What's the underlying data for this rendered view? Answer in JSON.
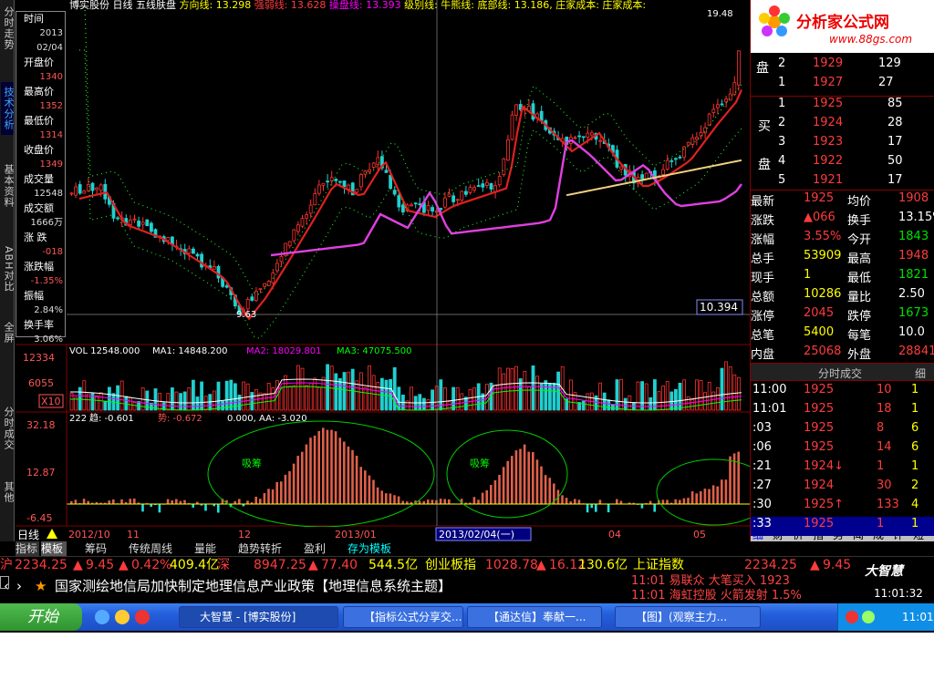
{
  "side_tabs": [
    "分时走势",
    "技术分析",
    "基本资料",
    "ABH对比",
    "全屏",
    "分时成交",
    "其他"
  ],
  "info": {
    "time_label": "时间",
    "time_year": "2013",
    "time_date": "02/04",
    "open_label": "开盘价",
    "open": "1340",
    "high_label": "最高价",
    "high": "1352",
    "low_label": "最低价",
    "low": "1314",
    "close_label": "收盘价",
    "close": "1349",
    "vol_label": "成交量",
    "vol": "12548",
    "amt_label": "成交额",
    "amt": "1666万",
    "chg_label": "涨 跌",
    "chg": "-018",
    "chgpct_label": "涨跌幅",
    "chgpct": "-1.35%",
    "amp_label": "振幅",
    "amp": "2.84%",
    "turn_label": "换手率",
    "turn": "3.06%"
  },
  "main_title": {
    "stock": "博实股份",
    "period": "日线",
    "indicator": "五线肤盘",
    "l1": "方向线: 13.298",
    "l2": "强弱线: 13.628",
    "l3": "操盘线: 13.393",
    "l4": "级别线: 牛熊线: 底部线: 13.186, 庄家成本: 庄家成本:",
    "top_price": "19.48",
    "low_mark": "9.63",
    "price_box": "10.394"
  },
  "vol_panel": {
    "title": "VOL 12548.000",
    "ma1": "MA1: 14848.200",
    "ma2": "MA2: 18029.801",
    "ma3": "MA3: 47075.500",
    "y1": "12334",
    "y2": "6055",
    "y3": "X10"
  },
  "ind_panel": {
    "title": "222",
    "qu": "趋: -0.601",
    "shi": "势: -0.672",
    "z": "0.000, AA: -3.020",
    "y1": "32.18",
    "y2": "12.87",
    "y3": "-6.45",
    "label1": "吸筹",
    "label2": "吸筹"
  },
  "xaxis": {
    "period": "日线",
    "d1": "2012/10",
    "d2": "11",
    "d3": "12",
    "d4": "2013/01",
    "cursor": "2013/02/04(一)",
    "d5": "04",
    "d6": "05"
  },
  "right": {
    "logo": "分析家公式网",
    "url": "www.88gs.com",
    "sell_label": "盘",
    "buy_label1": "买",
    "buy_label2": "盘",
    "ask_rows": [
      {
        "n": "2",
        "p": "1929",
        "v": "129"
      },
      {
        "n": "1",
        "p": "1927",
        "v": "27"
      }
    ],
    "bid_rows": [
      {
        "n": "1",
        "p": "1925",
        "v": "85"
      },
      {
        "n": "2",
        "p": "1924",
        "v": "28"
      },
      {
        "n": "3",
        "p": "1923",
        "v": "17"
      },
      {
        "n": "4",
        "p": "1922",
        "v": "50"
      },
      {
        "n": "5",
        "p": "1921",
        "v": "17"
      }
    ],
    "stats": [
      {
        "k1": "最新",
        "v1": "1925",
        "k2": "均价",
        "v2": "1908"
      },
      {
        "k1": "涨跌",
        "v1": "▲066",
        "k2": "换手",
        "v2": "13.15%"
      },
      {
        "k1": "涨幅",
        "v1": "3.55%",
        "k2": "今开",
        "v2": "1843"
      },
      {
        "k1": "总手",
        "v1": "53909",
        "k2": "最高",
        "v2": "1948"
      },
      {
        "k1": "现手",
        "v1": "1",
        "k2": "最低",
        "v2": "1821"
      },
      {
        "k1": "总额",
        "v1": "10286",
        "k2": "量比",
        "v2": "2.50"
      },
      {
        "k1": "涨停",
        "v1": "2045",
        "k2": "跌停",
        "v2": "1673"
      },
      {
        "k1": "总笔",
        "v1": "5400",
        "k2": "每笔",
        "v2": "10.0"
      },
      {
        "k1": "内盘",
        "v1": "25068",
        "k2": "外盘",
        "v2": "28841"
      }
    ],
    "trades_title": "分时成交",
    "trades_fine": "细",
    "trades": [
      {
        "t": "11:00",
        "p": "1925",
        "v": "10",
        "n": "1"
      },
      {
        "t": "11:01",
        "p": "1925",
        "v": "18",
        "n": "1"
      },
      {
        "t": ":03",
        "p": "1925",
        "v": "8",
        "n": "6"
      },
      {
        "t": ":06",
        "p": "1925",
        "v": "14",
        "n": "6"
      },
      {
        "t": ":21",
        "p": "1924↓",
        "v": "1",
        "n": "1"
      },
      {
        "t": ":27",
        "p": "1924",
        "v": "30",
        "n": "2"
      },
      {
        "t": ":30",
        "p": "1925↑",
        "v": "133",
        "n": "4"
      },
      {
        "t": ":33",
        "p": "1925",
        "v": "1",
        "n": "1"
      }
    ],
    "bottom_tabs": [
      "细",
      "财",
      "价",
      "指",
      "势",
      "闻",
      "成",
      "评",
      "短"
    ]
  },
  "bottom_tabs": [
    "指标",
    "模板",
    "筹码",
    "传统周线",
    "量能",
    "趋势转折",
    "盈利",
    "存为模板"
  ],
  "ticker": {
    "sh_label": "沪",
    "sh": "2234.25",
    "sh_chg": "9.45",
    "sh_pct": "0.42%",
    "sh_amt": "409.4亿",
    "sz_label": "深",
    "sz": "8947.25",
    "sz_chg": "77.40",
    "sz_amt": "544.5亿",
    "cy_label": "创业板指",
    "cy": "1028.78",
    "cy_chg": "16.12",
    "cy_amt": "130.6亿",
    "sz_index": "上证指数",
    "sz_index_v": "2234.25",
    "sz_index_c": "9.45"
  },
  "news": "国家测绘地信局加快制定地理信息产业政策【地理信息系统主题】",
  "alerts": [
    "11:01 易联众  大笔买入 1923",
    "11:01 海虹控股 火箭发射 1.5%"
  ],
  "brand": "大智慧",
  "clock": "11:01:32",
  "taskbar": {
    "start": "开始",
    "tasks": [
      "大智慧 - [博实股份]",
      "【指标公式分享交...",
      "【通达信】奉献一...",
      "【图】(观察主力..."
    ],
    "time": "11:01"
  }
}
